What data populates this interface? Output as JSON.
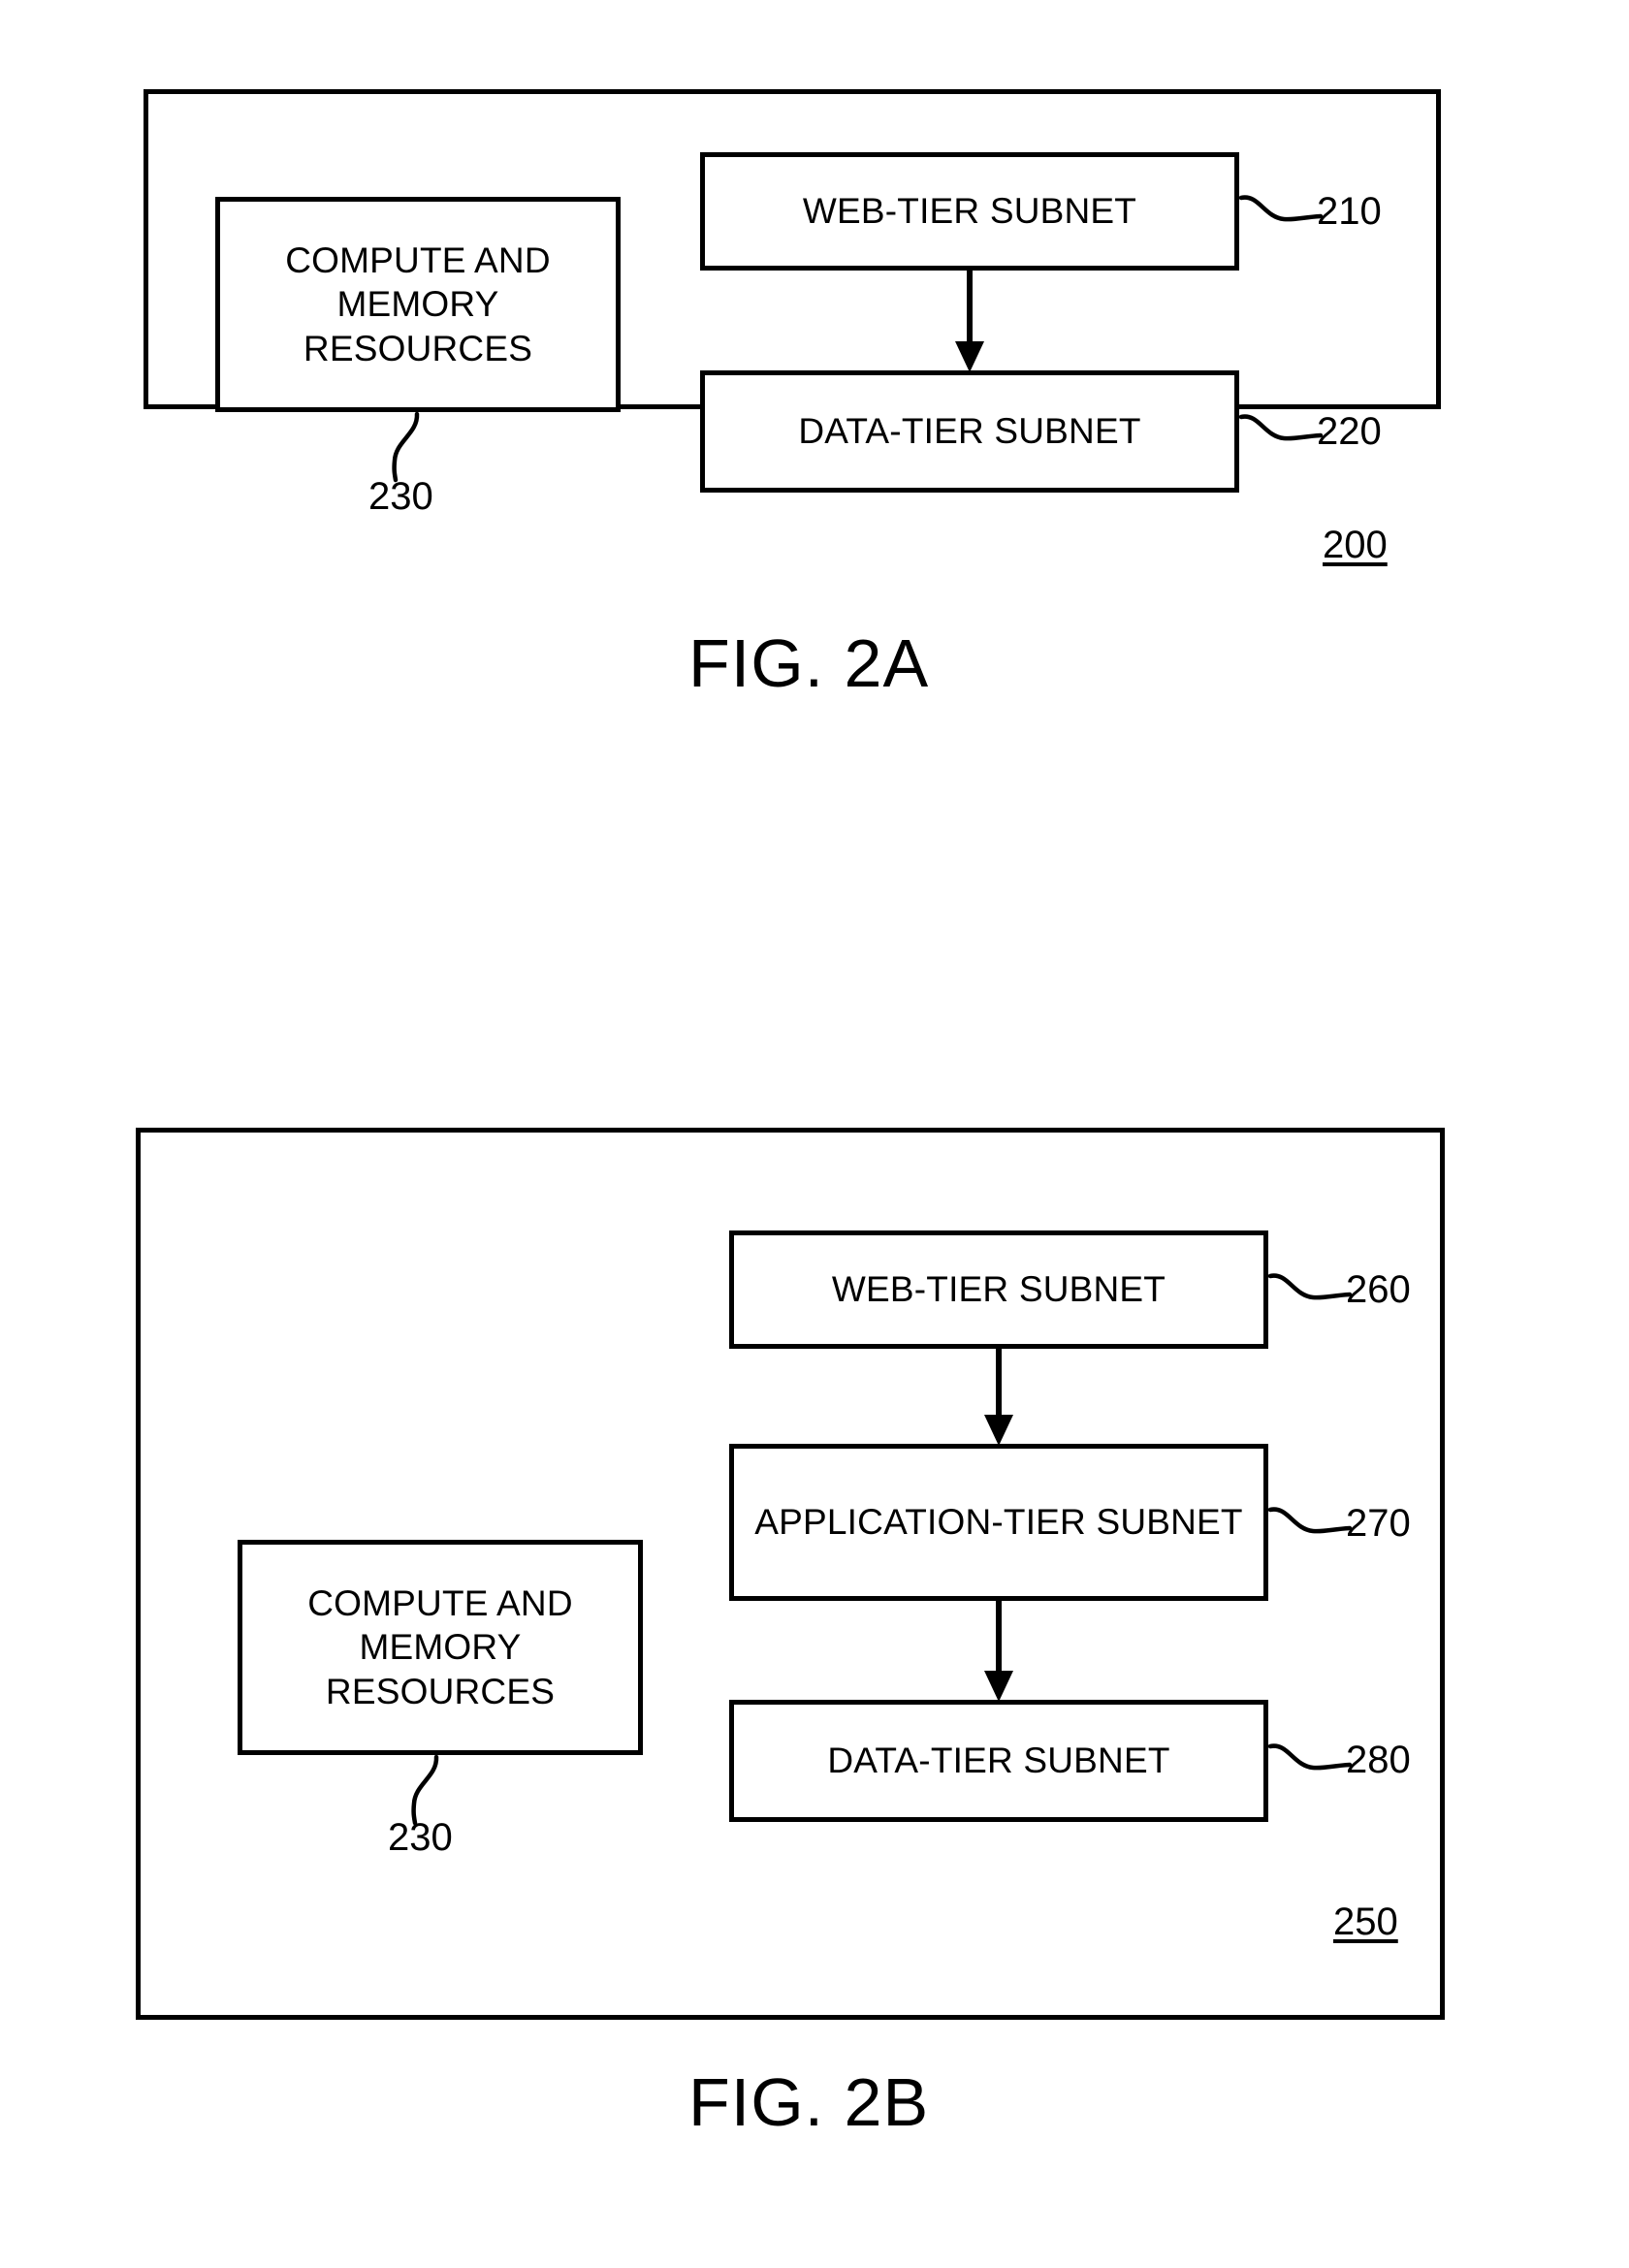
{
  "document": {
    "kind": "patent-drawing-sheet",
    "figures": [
      "FIG. 2A",
      "FIG. 2B"
    ]
  },
  "fig2a": {
    "caption": "FIG. 2A",
    "container_ref": "200",
    "nodes": {
      "compute": {
        "label": "COMPUTE AND MEMORY RESOURCES",
        "ref": "230"
      },
      "web_tier": {
        "label": "WEB-TIER SUBNET",
        "ref": "210"
      },
      "data_tier": {
        "label": "DATA-TIER SUBNET",
        "ref": "220"
      }
    },
    "flow": [
      {
        "from": "WEB-TIER SUBNET",
        "to": "DATA-TIER SUBNET",
        "style": "solid-arrow-down"
      }
    ]
  },
  "fig2b": {
    "caption": "FIG. 2B",
    "container_ref": "250",
    "nodes": {
      "compute": {
        "label": "COMPUTE AND MEMORY RESOURCES",
        "ref": "230"
      },
      "web_tier": {
        "label": "WEB-TIER SUBNET",
        "ref": "260"
      },
      "app_tier": {
        "label": "APPLICATION-TIER SUBNET",
        "ref": "270"
      },
      "data_tier": {
        "label": "DATA-TIER SUBNET",
        "ref": "280"
      }
    },
    "flow": [
      {
        "from": "WEB-TIER SUBNET",
        "to": "APPLICATION-TIER SUBNET",
        "style": "solid-arrow-down"
      },
      {
        "from": "APPLICATION-TIER SUBNET",
        "to": "DATA-TIER SUBNET",
        "style": "solid-arrow-down"
      }
    ]
  },
  "colors": {
    "ink": "#000000",
    "paper": "#ffffff"
  }
}
